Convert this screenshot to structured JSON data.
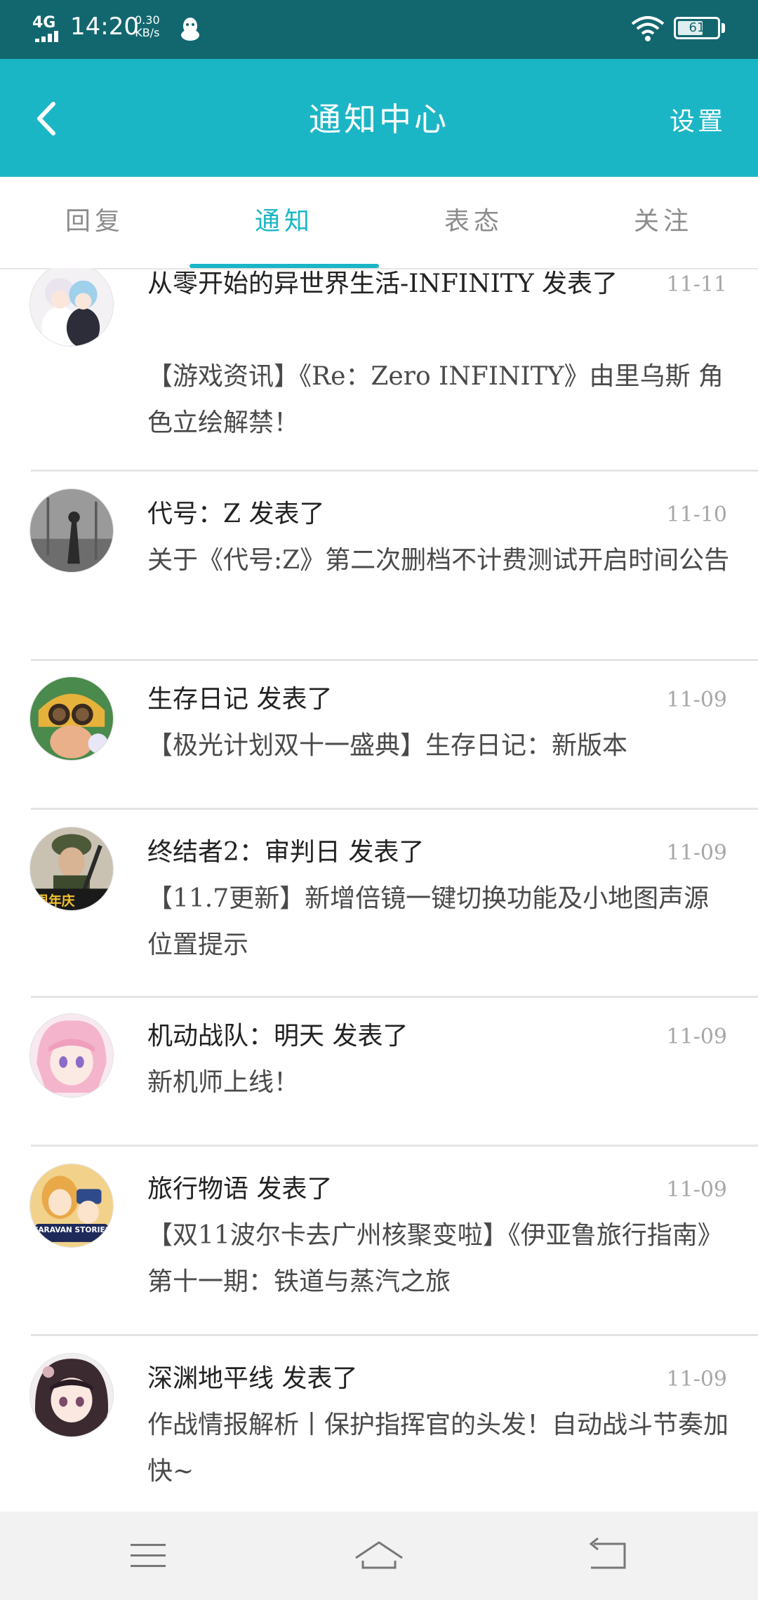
{
  "status_bar": {
    "network": "4G",
    "time": "14:20",
    "speed_value": "0.30",
    "speed_unit": "KB/s",
    "battery": "61"
  },
  "header": {
    "back_icon": "chevron-left-icon",
    "title": "通知中心",
    "settings_label": "设置"
  },
  "tabs": [
    {
      "label": "回复",
      "active": false
    },
    {
      "label": "通知",
      "active": true
    },
    {
      "label": "表态",
      "active": false
    },
    {
      "label": "关注",
      "active": false
    }
  ],
  "notifications": [
    {
      "title": "从零开始的异世界生活-INFINITY 发表了",
      "date": "11-11",
      "body": "【游戏资讯】《Re：Zero INFINITY》由里乌斯 角色立绘解禁！",
      "avatar": "anime-maids-avatar"
    },
    {
      "title": "代号：Z 发表了",
      "date": "11-10",
      "body": "关于《代号:Z》第二次删档不计费测试开启时间公告",
      "avatar": "silhouette-avatar"
    },
    {
      "title": "生存日记 发表了",
      "date": "11-09",
      "body": "【极光计划双十一盛典】生存日记：新版本",
      "avatar": "goggles-character-avatar"
    },
    {
      "title": "终结者2：审判日 发表了",
      "date": "11-09",
      "body": "【11.7更新】新增倍镜一键切换功能及小地图声源位置提示",
      "avatar": "soldier-avatar",
      "avatar_badge": "周年庆"
    },
    {
      "title": "机动战队：明天 发表了",
      "date": "11-09",
      "body": "新机师上线！",
      "avatar": "pink-hair-girl-avatar"
    },
    {
      "title": "旅行物语 发表了",
      "date": "11-09",
      "body": "【双11波尔卡去广州核聚变啦】《伊亚鲁旅行指南》第十一期：铁道与蒸汽之旅",
      "avatar": "caravan-stories-avatar",
      "avatar_badge": "CARAVAN STORIES"
    },
    {
      "title": "深渊地平线 发表了",
      "date": "11-09",
      "body": "作战情报解析丨保护指挥官的头发！自动战斗节奏加快~",
      "avatar": "dark-hair-girl-avatar"
    }
  ],
  "nav_bar": {
    "menu_icon": "menu-icon",
    "home_icon": "home-icon",
    "back_icon": "back-icon"
  },
  "colors": {
    "status_bar": "#12676f",
    "header": "#1bb6c6",
    "accent": "#1bb6c6",
    "date": "#a7a7a7"
  }
}
